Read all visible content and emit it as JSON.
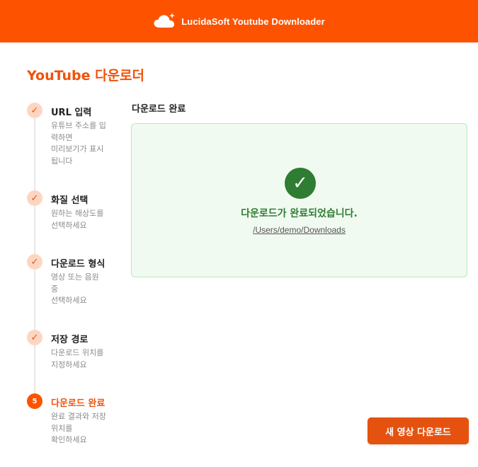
{
  "header": {
    "title": "LucidaSoft Youtube Downloader",
    "logo_icon": "cloud-sparkle-icon"
  },
  "page": {
    "title": "YouTube 다운로더"
  },
  "steps": [
    {
      "marker": "✓",
      "label": "URL 입력",
      "desc": "유튜브 주소를 입\n력하면\n미리보기가 표시\n됩니다",
      "state": "done"
    },
    {
      "marker": "✓",
      "label": "화질 선택",
      "desc": "원하는 해상도를\n선택하세요",
      "state": "done"
    },
    {
      "marker": "✓",
      "label": "다운로드 형식",
      "desc": "영상 또는 음원\n중\n선택하세요",
      "state": "done"
    },
    {
      "marker": "✓",
      "label": "저장 경로",
      "desc": "다운로드 위치를\n지정하세요",
      "state": "done"
    },
    {
      "marker": "5",
      "label": "다운로드 완료",
      "desc": "완료 결과와 저장\n위치를\n확인하세요",
      "state": "active"
    }
  ],
  "main": {
    "section_title": "다운로드 완료",
    "result": {
      "check_glyph": "✓",
      "message": "다운로드가 완료되었습니다.",
      "path": "/Users/demo/Downloads"
    },
    "new_download_label": "새 영상 다운로드"
  },
  "colors": {
    "accent": "#fd5200",
    "success": "#2e7d32",
    "success_bg": "#f1faf1"
  }
}
